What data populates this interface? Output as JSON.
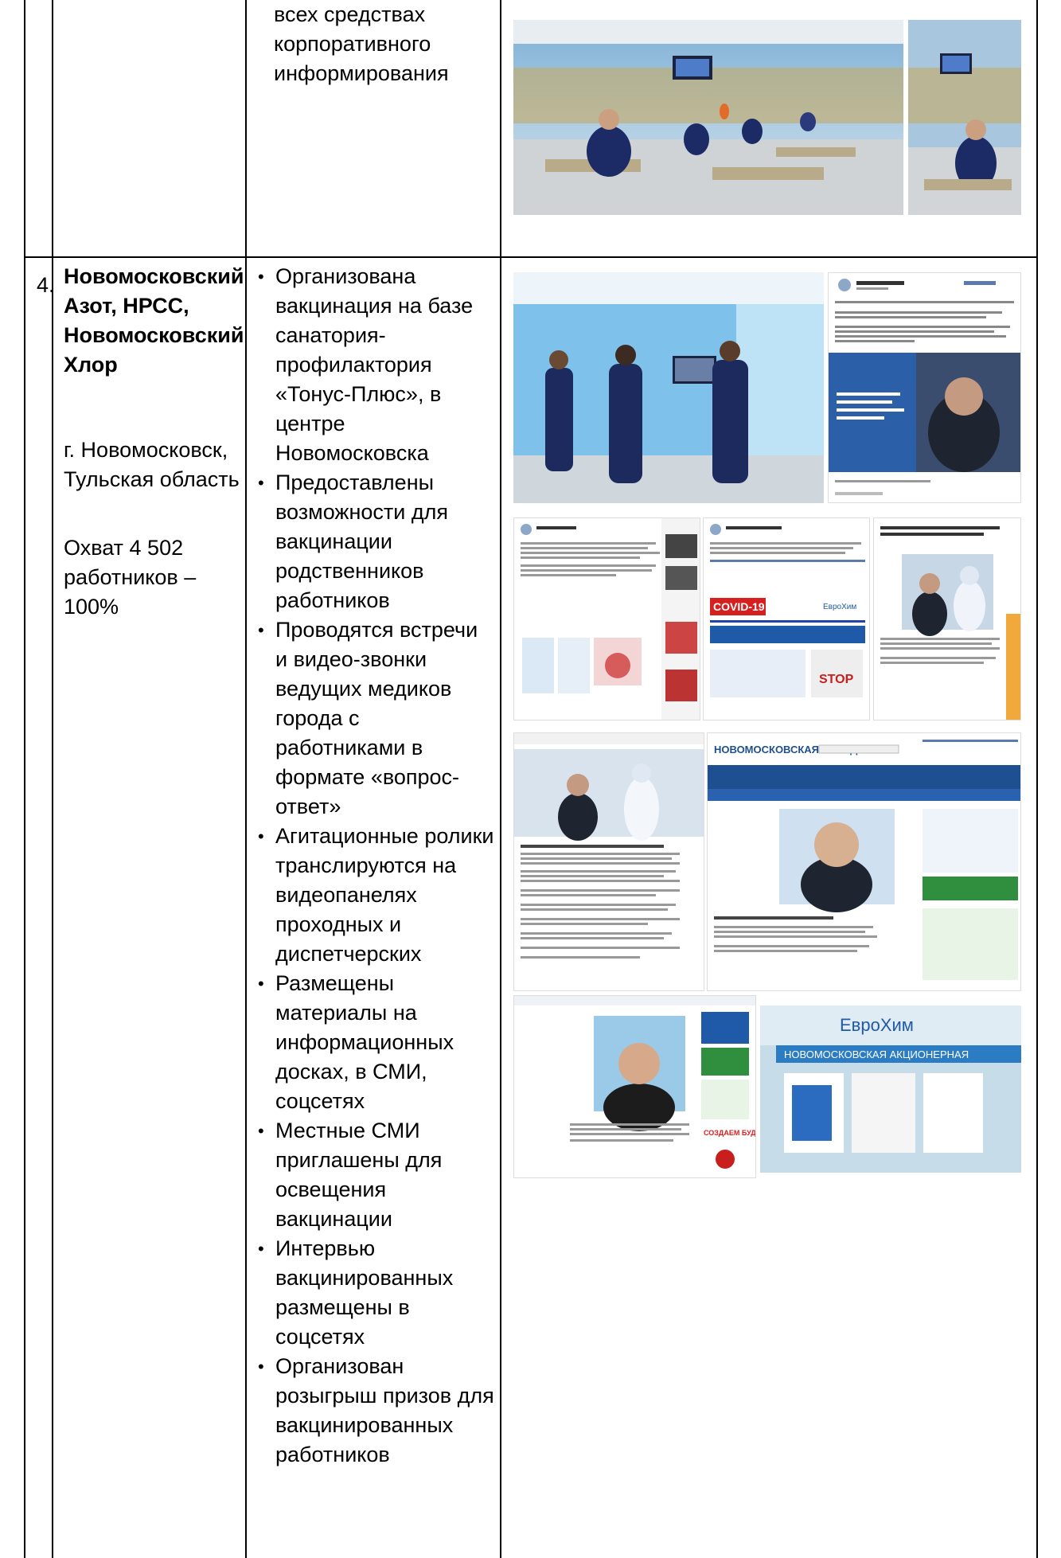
{
  "continuation_text": "всех средствах корпоративного информирования",
  "row": {
    "number": "4.",
    "company": "Новомосковский Азот, НРСС, Новомосковский Хлор",
    "city": "г. Новомосковск, Тульская область",
    "coverage": "Охват 4 502 работников – 100%",
    "measures": [
      "Организована вакцинация на базе санатория-профилактория «Тонус-Плюс», в центре Новомосковска",
      "Предоставлены возможности для вакцинации родственников работников",
      "Проводятся встречи и видео-звонки ведущих медиков города с работниками в формате «вопрос-ответ»",
      "Агитационные ролики транслируются на видеопанелях проходных и диспетчерских",
      "Размещены материалы на информационных досках, в СМИ, соцсетях",
      "Местные СМИ приглашены для освещения вакцинации",
      "Интервью вакцинированных размещены в соцсетях",
      "Организован розыгрыш призов для вакцинированных работников"
    ]
  },
  "photo_texts": {
    "covid": "COVID-19",
    "eurochem": "ЕвроХим",
    "newspaper": "НОВОМОСКОВСКАЯ ПРАВДА",
    "banner": "НОВОМОСКОВСКАЯ АКЦИОНЕРНАЯ",
    "stop": "STOP",
    "sozdaem": "СОЗДАЕМ БУДУЩЕЕ"
  },
  "colors": {
    "border": "#000000",
    "brand_blue": "#1f5aa8"
  }
}
